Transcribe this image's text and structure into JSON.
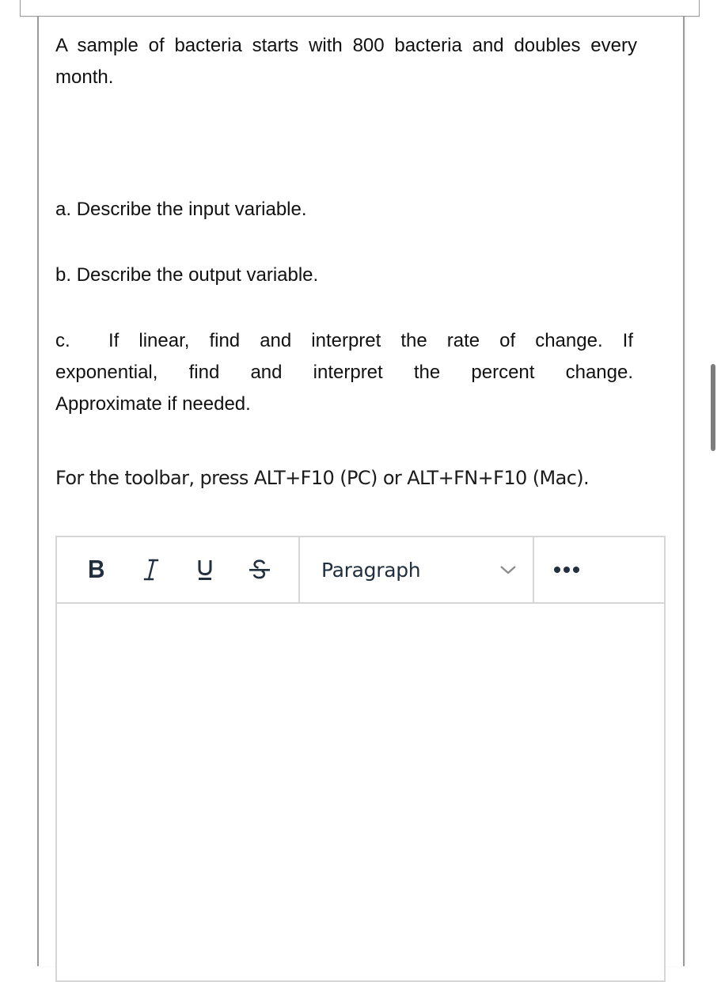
{
  "question": {
    "intro": "A sample of bacteria starts with 800 bacteria and doubles every month.",
    "parts": [
      {
        "label": "a.",
        "text": "Describe the input variable."
      },
      {
        "label": "b.",
        "text": "Describe the output variable."
      },
      {
        "label": "c.",
        "text": "If linear, find and interpret the rate of change.  If exponential, find and interpret the percent change. Approximate if needed.",
        "lines": [
          "If linear, find and interpret the rate of change.  If",
          "exponential, find and interpret the percent change.",
          "Approximate if needed."
        ]
      }
    ]
  },
  "editor": {
    "hint": "For the toolbar, press ALT+F10 (PC) or ALT+FN+F10 (Mac).",
    "toolbar": {
      "format_buttons": [
        {
          "name": "bold",
          "icon": "bold-icon"
        },
        {
          "name": "italic",
          "icon": "italic-icon"
        },
        {
          "name": "underline",
          "icon": "underline-icon"
        },
        {
          "name": "strikethrough",
          "icon": "strikethrough-icon"
        }
      ],
      "block_format": {
        "selected": "Paragraph",
        "icon": "chevron-down-icon"
      },
      "more": {
        "icon": "more-horizontal-icon"
      }
    },
    "content": ""
  },
  "colors": {
    "toolbar_icon": "#222f3e",
    "border": "#d6d6d6",
    "panel_border": "#9b9b9b",
    "text": "#111111"
  }
}
